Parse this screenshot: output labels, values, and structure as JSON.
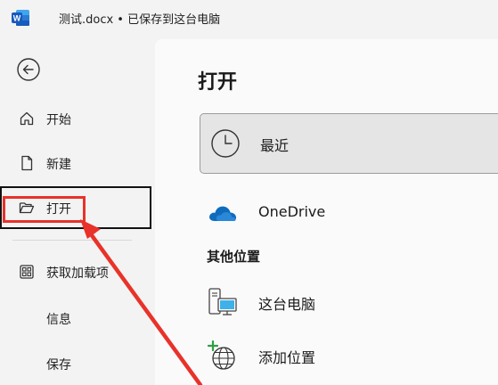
{
  "titlebar": {
    "app_icon": "word-logo",
    "app_letter": "W",
    "document_title": "测试.docx • 已保存到这台电脑"
  },
  "sidebar": {
    "back_icon": "back-arrow-icon",
    "items": [
      {
        "label": "开始",
        "icon": "home-icon"
      },
      {
        "label": "新建",
        "icon": "new-document-icon"
      },
      {
        "label": "打开",
        "icon": "open-folder-icon"
      },
      {
        "label": "获取加载项",
        "icon": "add-ins-grid-icon"
      },
      {
        "label": "信息",
        "icon": ""
      },
      {
        "label": "保存",
        "icon": ""
      }
    ]
  },
  "main": {
    "title": "打开",
    "recent": {
      "label": "最近",
      "icon": "clock-icon"
    },
    "onedrive": {
      "label": "OneDrive",
      "icon": "onedrive-cloud-icon"
    },
    "other_locations_heading": "其他位置",
    "this_pc": {
      "label": "这台电脑",
      "icon": "this-pc-icon"
    },
    "add_location": {
      "label": "添加位置",
      "icon": "add-location-globe-icon"
    }
  },
  "annotations": {
    "highlight_color": "#e8322a",
    "frame_color": "#111111"
  },
  "colors": {
    "word_blue": "#185abd",
    "onedrive_blue": "#0f6cbd",
    "background": "#f3f3f3",
    "panel": "#fafafa"
  }
}
